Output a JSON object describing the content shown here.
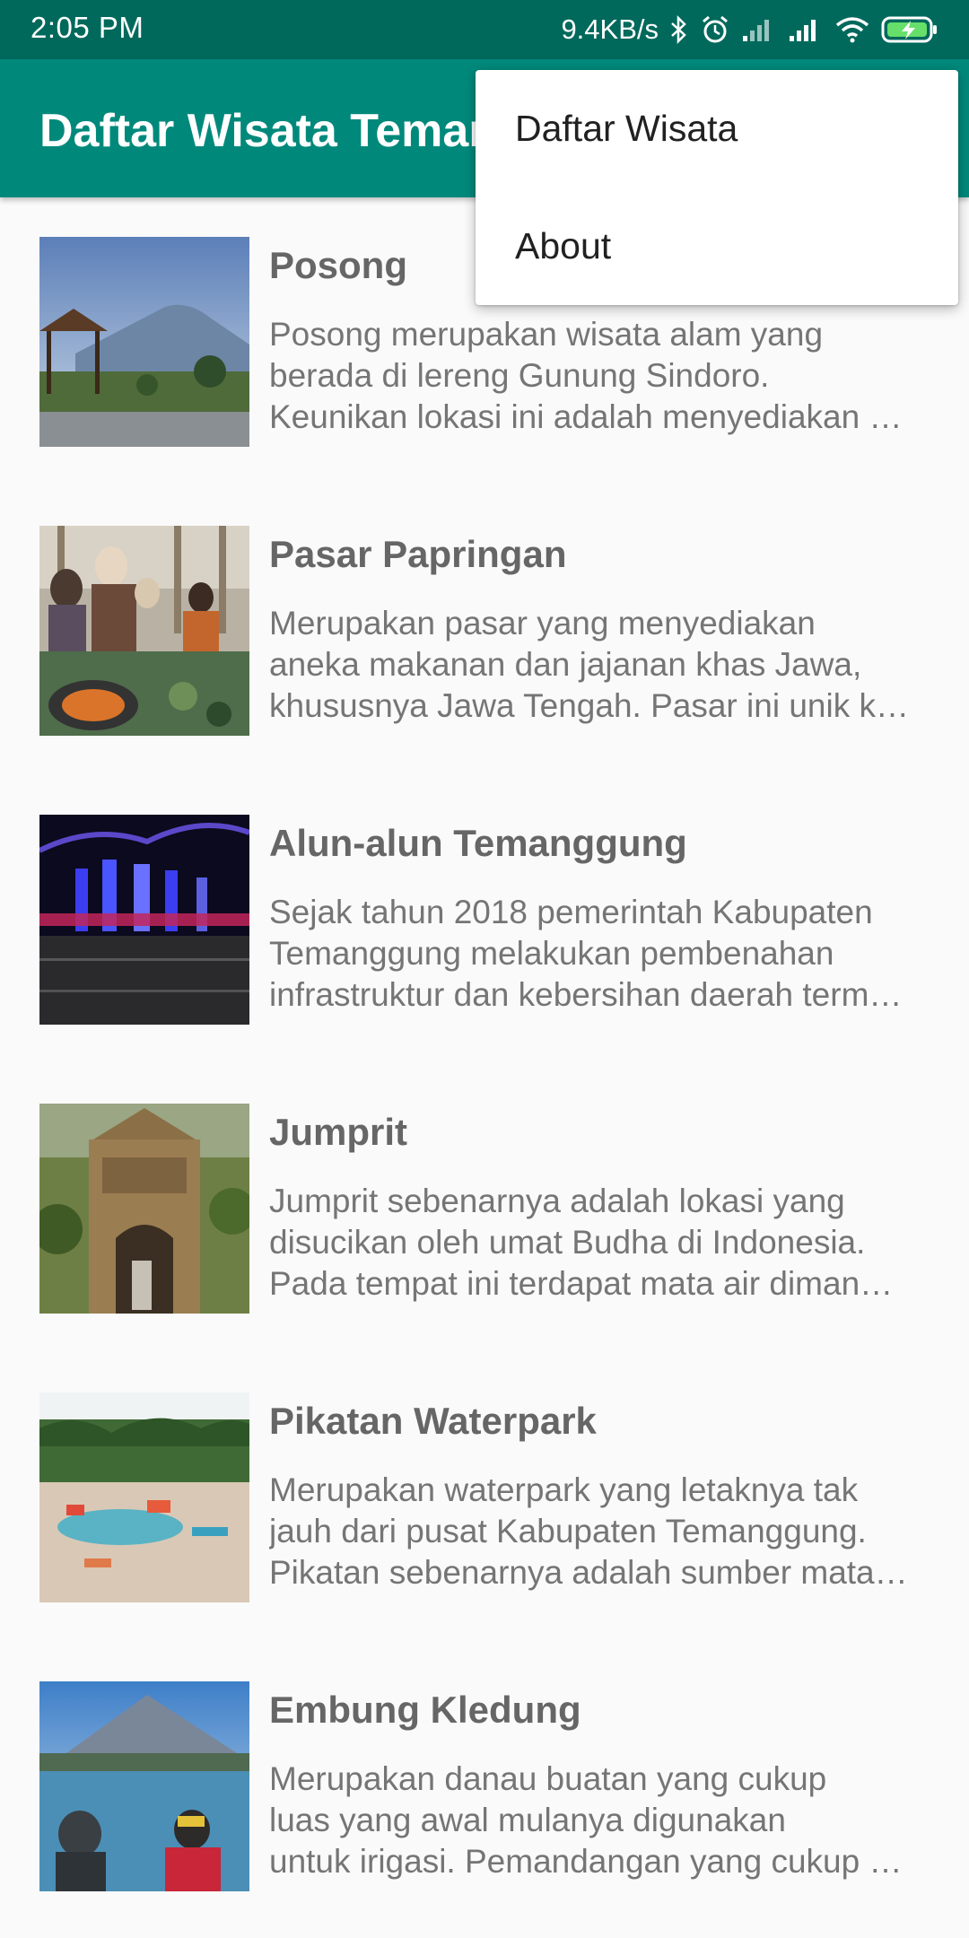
{
  "status_bar": {
    "time": "2:05 PM",
    "net_speed": "9.4KB/s",
    "icons": [
      "bluetooth-icon",
      "alarm-icon",
      "signal-icon",
      "signal-icon",
      "wifi-icon",
      "battery-charging-icon"
    ]
  },
  "app_bar": {
    "title": "Daftar Wisata Temanggung"
  },
  "menu": {
    "items": [
      {
        "label": "Daftar Wisata"
      },
      {
        "label": "About"
      }
    ]
  },
  "list": {
    "items": [
      {
        "title": "Posong",
        "lines": [
          "Posong merupakan wisata alam yang",
          "berada di lereng Gunung Sindoro.",
          "Keunikan lokasi ini adalah menyediakan …"
        ]
      },
      {
        "title": "Pasar Papringan",
        "lines": [
          "Merupakan pasar yang menyediakan",
          "aneka makanan dan jajanan khas Jawa,",
          "khususnya Jawa Tengah. Pasar ini unik k…"
        ]
      },
      {
        "title": "Alun-alun Temanggung",
        "lines": [
          "Sejak tahun 2018 pemerintah Kabupaten",
          "Temanggung melakukan pembenahan",
          "infrastruktur dan kebersihan daerah term…"
        ]
      },
      {
        "title": "Jumprit",
        "lines": [
          "Jumprit sebenarnya adalah lokasi yang",
          "disucikan oleh umat Budha di Indonesia.",
          "Pada tempat ini terdapat mata air diman…"
        ]
      },
      {
        "title": "Pikatan Waterpark",
        "lines": [
          "Merupakan waterpark yang letaknya tak",
          "jauh dari pusat Kabupaten Temanggung.",
          "Pikatan sebenarnya adalah sumber mata…"
        ]
      },
      {
        "title": "Embung Kledung",
        "lines": [
          "Merupakan danau buatan yang cukup",
          "luas yang awal mulanya digunakan",
          "untuk irigasi. Pemandangan yang cukup …"
        ]
      }
    ]
  },
  "colors": {
    "status_bar": "#00695c",
    "app_bar": "#00897b",
    "title_text": "#666666",
    "desc_text": "#757575"
  }
}
